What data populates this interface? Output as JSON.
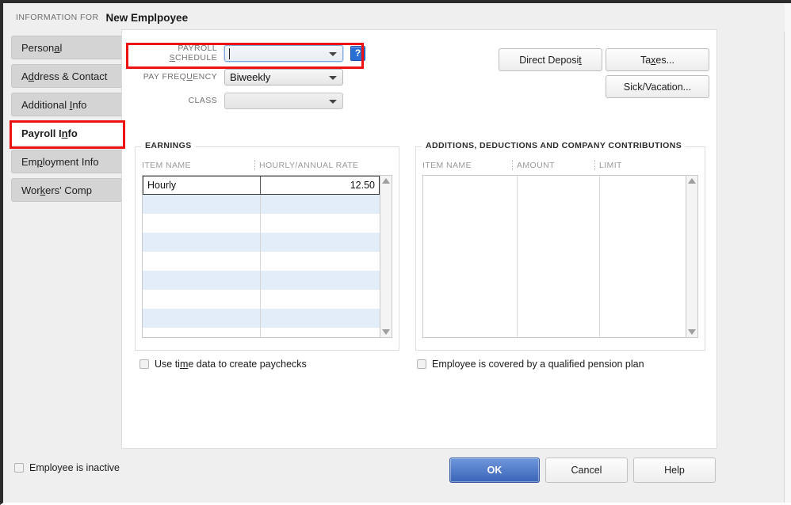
{
  "header": {
    "kicker": "INFORMATION FOR",
    "title": "New Emplpoyee"
  },
  "sidebar": {
    "items": [
      {
        "label": "Person",
        "mnemonic": "a",
        "tail": "l",
        "active": false
      },
      {
        "label": "A",
        "mnemonic": "d",
        "tail": "dress & Contact",
        "active": false
      },
      {
        "label": "Additional ",
        "mnemonic": "I",
        "tail": "nfo",
        "active": false
      },
      {
        "label": "Payroll I",
        "mnemonic": "n",
        "tail": "fo",
        "active": true
      },
      {
        "label": "Em",
        "mnemonic": "p",
        "tail": "loyment Info",
        "active": false
      },
      {
        "label": "Wor",
        "mnemonic": "k",
        "tail": "ers' Comp",
        "active": false
      }
    ]
  },
  "form": {
    "payroll_schedule": {
      "label_pre": "PAYROLL ",
      "label_mn": "S",
      "label_post": "CHEDULE",
      "value": "",
      "focused": true,
      "help_icon": "question-help-icon",
      "help_label": "?"
    },
    "pay_frequency": {
      "label_pre": "PAY FREQ",
      "label_mn": "U",
      "label_post": "ENCY",
      "value": "Biweekly"
    },
    "class": {
      "label_pre": "CLASS",
      "label_mn": "",
      "label_post": "",
      "value": ""
    }
  },
  "buttons": {
    "direct_deposit": {
      "pre": "Direct Deposi",
      "mn": "t",
      "post": ""
    },
    "taxes": {
      "pre": "Ta",
      "mn": "x",
      "post": "es..."
    },
    "sick_vacation": {
      "pre": "Sick/Vacation...",
      "mn": "",
      "post": ""
    }
  },
  "earnings": {
    "title": "EARNINGS",
    "columns": [
      "ITEM NAME",
      "HOURLY/ANNUAL RATE"
    ],
    "rows": [
      {
        "item_name": "Hourly",
        "rate": "12.50",
        "selected": true
      },
      {
        "item_name": "",
        "rate": "",
        "selected": false
      },
      {
        "item_name": "",
        "rate": "",
        "selected": false
      },
      {
        "item_name": "",
        "rate": "",
        "selected": false
      },
      {
        "item_name": "",
        "rate": "",
        "selected": false
      },
      {
        "item_name": "",
        "rate": "",
        "selected": false
      },
      {
        "item_name": "",
        "rate": "",
        "selected": false
      },
      {
        "item_name": "",
        "rate": "",
        "selected": false
      },
      {
        "item_name": "",
        "rate": "",
        "selected": false
      }
    ]
  },
  "additions": {
    "title": "ADDITIONS, DEDUCTIONS AND COMPANY CONTRIBUTIONS",
    "columns": [
      "ITEM NAME",
      "AMOUNT",
      "LIMIT"
    ],
    "rows": []
  },
  "checkboxes": {
    "use_time_data": {
      "pre": "Use ti",
      "mn": "m",
      "post": "e data to create paychecks",
      "checked": false
    },
    "pension": {
      "pre": "Employee is covered by a qualified pension plan",
      "mn": "",
      "post": "",
      "checked": false
    },
    "inactive": {
      "label": "Employee is inactive",
      "checked": false
    }
  },
  "footer": {
    "ok": "OK",
    "cancel": "Cancel",
    "help": "Help"
  },
  "annotations": {
    "highlight_color": "#ee1111",
    "boxes": [
      "payroll-schedule-row",
      "payroll-info-tab"
    ]
  }
}
